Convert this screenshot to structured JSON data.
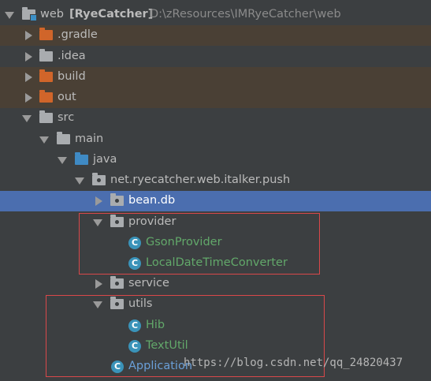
{
  "tree": {
    "root": {
      "name": "web",
      "module": "[RyeCatcher]",
      "path": "D:\\zResources\\IMRyeCatcher\\web"
    },
    "items": [
      {
        "label": ".gradle"
      },
      {
        "label": ".idea"
      },
      {
        "label": "build"
      },
      {
        "label": "out"
      },
      {
        "label": "src"
      },
      {
        "label": "main"
      },
      {
        "label": "java"
      },
      {
        "label": "net.ryecatcher.web.italker.push"
      },
      {
        "label": "bean.db"
      },
      {
        "label": "provider"
      },
      {
        "label": "GsonProvider"
      },
      {
        "label": "LocalDateTimeConverter"
      },
      {
        "label": "service"
      },
      {
        "label": "utils"
      },
      {
        "label": "Hib"
      },
      {
        "label": "TextUtil"
      },
      {
        "label": "Application"
      }
    ],
    "class_badge": "C"
  },
  "colors": {
    "background": "#3c3f41",
    "excluded_row": "#4a4035",
    "selected_row": "#4b6eaf",
    "highlight_box": "#d9484a",
    "class_text": "#62a86a"
  },
  "watermark": "https://blog.csdn.net/qq_24820437"
}
